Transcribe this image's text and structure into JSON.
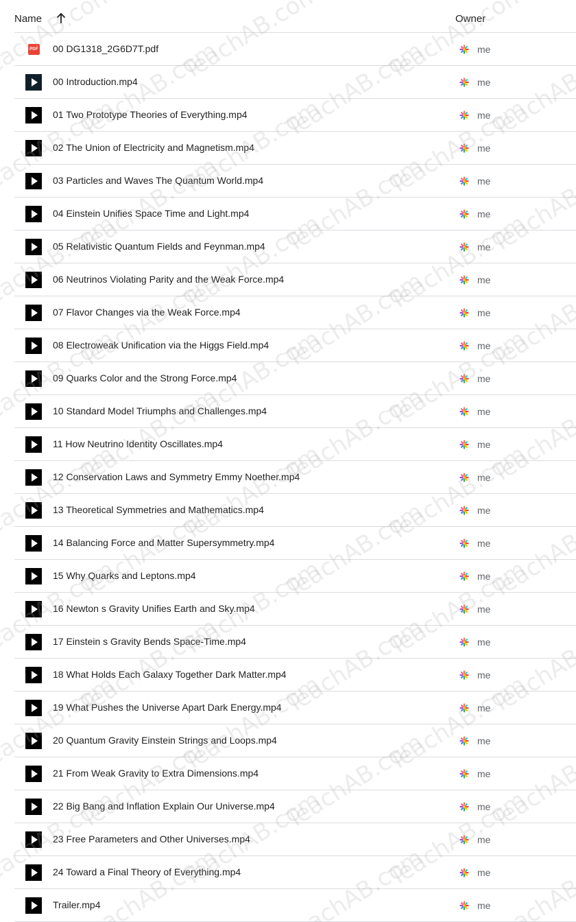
{
  "header": {
    "name_label": "Name",
    "owner_label": "Owner",
    "sort_icon": "arrow-up-icon"
  },
  "watermark_text": "TeachAB.com",
  "files": [
    {
      "name": "00 DG1318_2G6D7T.pdf",
      "type": "pdf",
      "icon": "pdf-icon",
      "owner": "me"
    },
    {
      "name": "00 Introduction.mp4",
      "type": "video-thumb",
      "icon": "video-icon",
      "owner": "me"
    },
    {
      "name": "01 Two Prototype Theories of Everything.mp4",
      "type": "video",
      "icon": "video-icon",
      "owner": "me"
    },
    {
      "name": "02 The Union of Electricity and Magnetism.mp4",
      "type": "video",
      "icon": "video-icon",
      "owner": "me"
    },
    {
      "name": "03 Particles and Waves The Quantum World.mp4",
      "type": "video",
      "icon": "video-icon",
      "owner": "me"
    },
    {
      "name": "04 Einstein Unifies Space Time and Light.mp4",
      "type": "video",
      "icon": "video-icon",
      "owner": "me"
    },
    {
      "name": "05 Relativistic Quantum Fields and Feynman.mp4",
      "type": "video",
      "icon": "video-icon",
      "owner": "me"
    },
    {
      "name": "06 Neutrinos Violating Parity and the Weak Force.mp4",
      "type": "video",
      "icon": "video-icon",
      "owner": "me"
    },
    {
      "name": "07 Flavor Changes via the Weak Force.mp4",
      "type": "video",
      "icon": "video-icon",
      "owner": "me"
    },
    {
      "name": "08 Electroweak Unification via the Higgs Field.mp4",
      "type": "video",
      "icon": "video-icon",
      "owner": "me"
    },
    {
      "name": "09 Quarks Color and the Strong Force.mp4",
      "type": "video",
      "icon": "video-icon",
      "owner": "me"
    },
    {
      "name": "10 Standard Model Triumphs and Challenges.mp4",
      "type": "video",
      "icon": "video-icon",
      "owner": "me"
    },
    {
      "name": "11 How Neutrino Identity Oscillates.mp4",
      "type": "video",
      "icon": "video-icon",
      "owner": "me"
    },
    {
      "name": "12 Conservation Laws and Symmetry Emmy Noether.mp4",
      "type": "video",
      "icon": "video-icon",
      "owner": "me"
    },
    {
      "name": "13 Theoretical Symmetries and Mathematics.mp4",
      "type": "video",
      "icon": "video-icon",
      "owner": "me"
    },
    {
      "name": "14 Balancing Force and Matter Supersymmetry.mp4",
      "type": "video",
      "icon": "video-icon",
      "owner": "me"
    },
    {
      "name": "15 Why Quarks and Leptons.mp4",
      "type": "video",
      "icon": "video-icon",
      "owner": "me"
    },
    {
      "name": "16 Newton s Gravity Unifies Earth and Sky.mp4",
      "type": "video",
      "icon": "video-icon",
      "owner": "me"
    },
    {
      "name": "17 Einstein s Gravity Bends Space-Time.mp4",
      "type": "video",
      "icon": "video-icon",
      "owner": "me"
    },
    {
      "name": "18 What Holds Each Galaxy Together Dark Matter.mp4",
      "type": "video",
      "icon": "video-icon",
      "owner": "me"
    },
    {
      "name": "19 What Pushes the Universe Apart Dark Energy.mp4",
      "type": "video",
      "icon": "video-icon",
      "owner": "me"
    },
    {
      "name": "20 Quantum Gravity Einstein Strings and Loops.mp4",
      "type": "video",
      "icon": "video-icon",
      "owner": "me"
    },
    {
      "name": "21 From Weak Gravity to Extra Dimensions.mp4",
      "type": "video",
      "icon": "video-icon",
      "owner": "me"
    },
    {
      "name": "22 Big Bang and Inflation Explain Our Universe.mp4",
      "type": "video",
      "icon": "video-icon",
      "owner": "me"
    },
    {
      "name": "23 Free Parameters and Other Universes.mp4",
      "type": "video",
      "icon": "video-icon",
      "owner": "me"
    },
    {
      "name": "24 Toward a Final Theory of Everything.mp4",
      "type": "video",
      "icon": "video-icon",
      "owner": "me"
    },
    {
      "name": "Trailer.mp4",
      "type": "video",
      "icon": "video-icon",
      "owner": "me"
    }
  ]
}
